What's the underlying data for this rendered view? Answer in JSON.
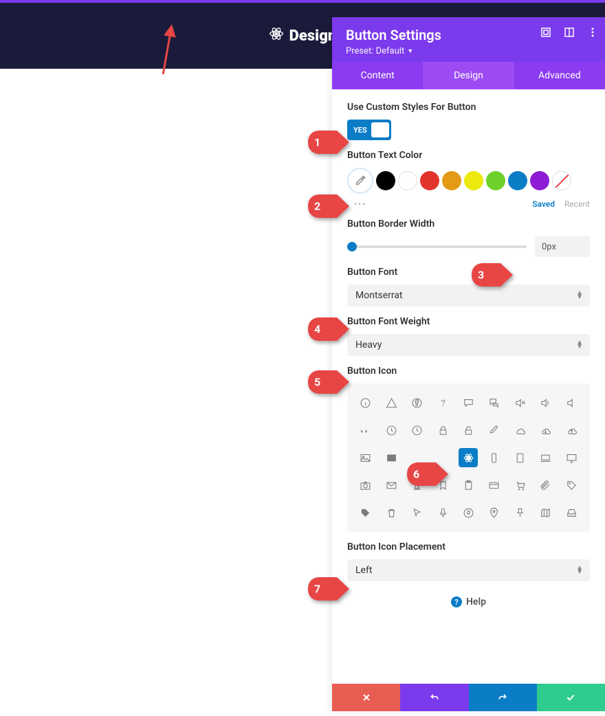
{
  "colors": {
    "accent_purple": "#7c3aed",
    "accent_blue": "#0b7dc7",
    "red": "#e85d52",
    "green": "#2ecc8f"
  },
  "topbar": {
    "title": "Design"
  },
  "panel": {
    "title": "Button Settings",
    "preset": "Preset: Default",
    "tabs": {
      "content": "Content",
      "design": "Design",
      "advanced": "Advanced"
    }
  },
  "sections": {
    "custom_styles_label": "Use Custom Styles For Button",
    "toggle_yes": "YES",
    "text_color_label": "Button Text Color",
    "saved": "Saved",
    "recent": "Recent",
    "border_width_label": "Button Border Width",
    "border_width_value": "0px",
    "font_label": "Button Font",
    "font_value": "Montserrat",
    "font_weight_label": "Button Font Weight",
    "font_weight_value": "Heavy",
    "icon_label": "Button Icon",
    "icon_placement_label": "Button Icon Placement",
    "icon_placement_value": "Left"
  },
  "swatches": [
    "#000000",
    "#ffffff",
    "#e0332b",
    "#e39a14",
    "#ece90f",
    "#6dd12b",
    "#0b7dc7",
    "#8e1bd6"
  ],
  "help": "Help",
  "annotations": [
    "1",
    "2",
    "3",
    "4",
    "5",
    "6",
    "7"
  ]
}
